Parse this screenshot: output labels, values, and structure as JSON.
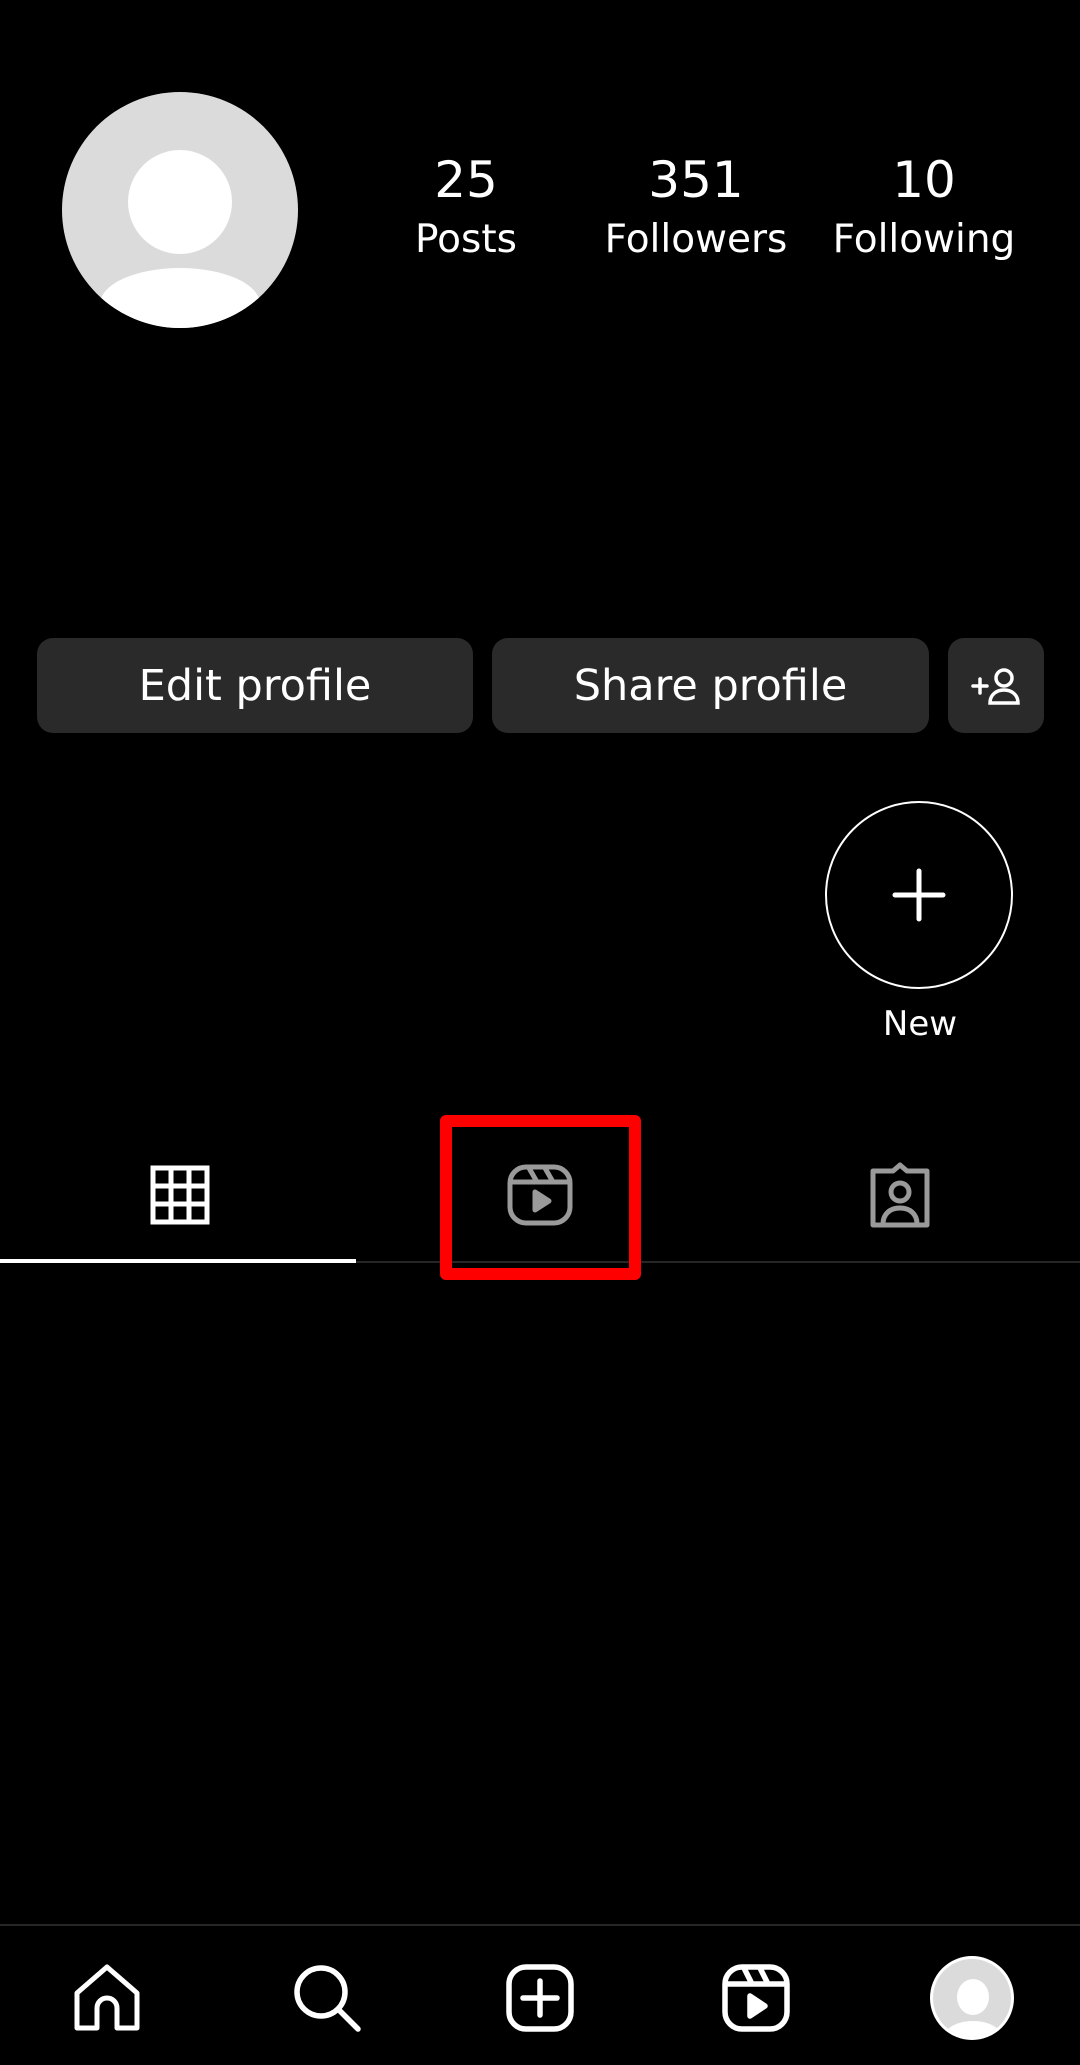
{
  "profile": {
    "stats": [
      {
        "value": "25",
        "label": "Posts"
      },
      {
        "value": "351",
        "label": "Followers"
      },
      {
        "value": "10",
        "label": "Following"
      }
    ]
  },
  "actions": {
    "edit_label": "Edit profile",
    "share_label": "Share profile",
    "discover_icon": "add-person-icon"
  },
  "highlights": {
    "new_label": "New"
  },
  "tabs": [
    {
      "name": "posts-grid",
      "icon": "grid-icon",
      "active": true
    },
    {
      "name": "reels",
      "icon": "reels-icon",
      "active": false,
      "highlighted": true
    },
    {
      "name": "tagged",
      "icon": "tagged-person-icon",
      "active": false
    }
  ],
  "bottom_nav": [
    "home-icon",
    "search-icon",
    "create-icon",
    "reels-icon",
    "profile-avatar"
  ],
  "colors": {
    "background": "#000000",
    "button": "#2a2a2a",
    "inactive_icon": "#9a9a9a",
    "highlight_box": "#ff0000",
    "avatar": "#dbdbdb"
  }
}
